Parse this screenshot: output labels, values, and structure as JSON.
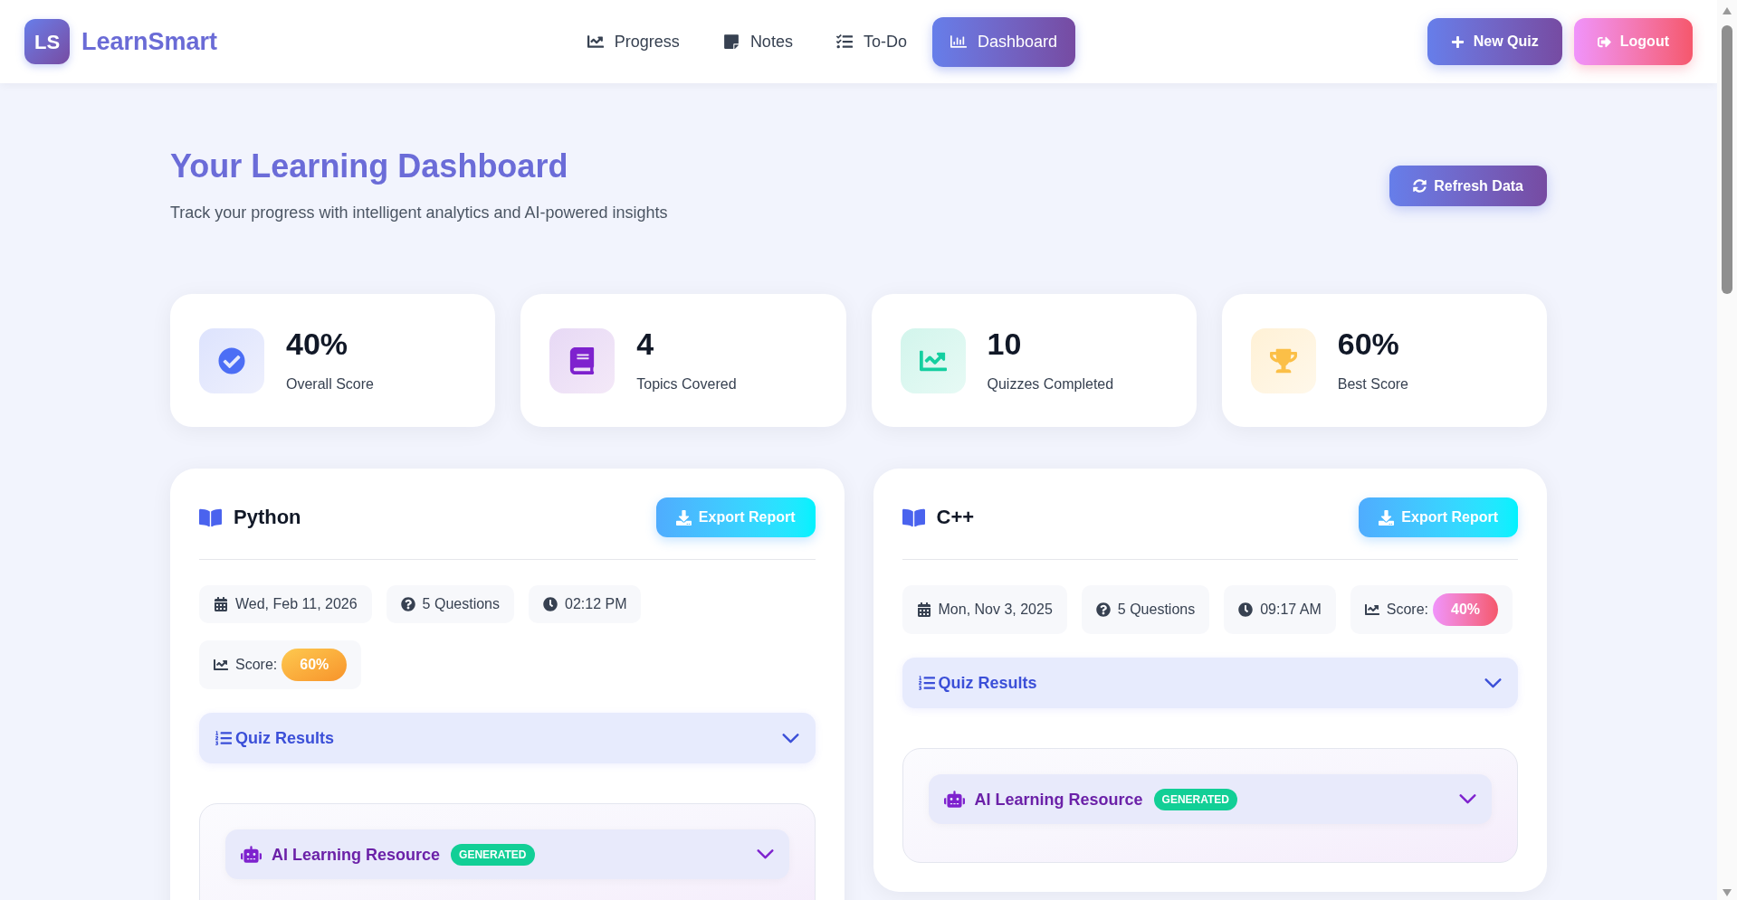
{
  "header": {
    "logo": {
      "mark": "LS",
      "name": "LearnSmart"
    },
    "nav": [
      {
        "label": "Progress",
        "kind": "progress",
        "selected": false
      },
      {
        "label": "Notes",
        "kind": "notes",
        "selected": false
      },
      {
        "label": "To-Do",
        "kind": "todo",
        "selected": false
      },
      {
        "label": "Dashboard",
        "kind": "dashboard",
        "selected": true
      }
    ],
    "actions": [
      {
        "label": "New Quiz",
        "kind": "new"
      },
      {
        "label": "Logout",
        "kind": "logout"
      }
    ]
  },
  "page": {
    "title": "Your Learning Dashboard",
    "subtitle": "Track your progress with intelligent analytics and AI-powered insights",
    "refresh_button": "Refresh Data"
  },
  "stats": [
    {
      "value": "40%",
      "label": "Overall Score",
      "kind": "score"
    },
    {
      "value": "4",
      "label": "Topics Covered",
      "kind": "topics"
    },
    {
      "value": "10",
      "label": "Quizzes Completed",
      "kind": "quizzes"
    },
    {
      "value": "60%",
      "label": "Best Score",
      "kind": "best"
    }
  ],
  "subjects": [
    {
      "title": "Python",
      "export_button": "Export Report",
      "date": "Wed, Feb 11, 2026",
      "questions": "5 Questions",
      "time": "02:12 PM",
      "score": {
        "label": "Score:",
        "value": "60%",
        "kind": "medium"
      },
      "quiz_results": {
        "label": "Quiz Results",
        "expanded": false
      },
      "ai_resource": {
        "label": "AI Learning Resource",
        "badge": "GENERATED",
        "expanded": false
      }
    },
    {
      "title": "C++",
      "export_button": "Export Report",
      "date": "Mon, Nov 3, 2025",
      "questions": "5 Questions",
      "time": "09:17 AM",
      "score": {
        "label": "Score:",
        "value": "40%",
        "kind": "low"
      },
      "quiz_results": {
        "label": "Quiz Results",
        "expanded": false
      },
      "ai_resource": {
        "label": "AI Learning Resource",
        "badge": "GENERATED",
        "expanded": false
      }
    }
  ]
}
